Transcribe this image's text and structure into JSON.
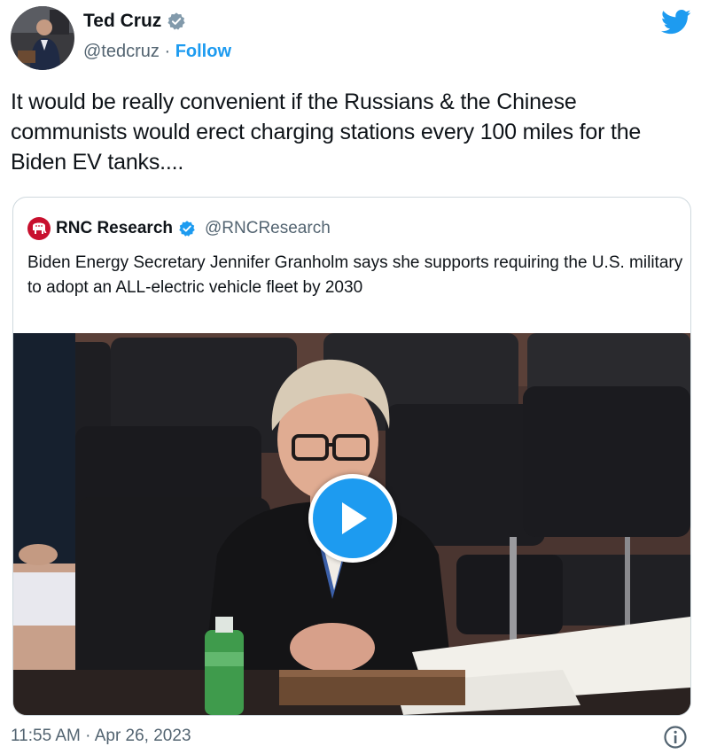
{
  "author": {
    "name": "Ted Cruz",
    "handle": "@tedcruz",
    "separator": "·",
    "follow_label": "Follow",
    "verified_icon": "verified-badge-icon"
  },
  "tweet": {
    "text": "It would be really convenient if the Russians & the Chinese communists would erect charging stations every 100 miles for the Biden EV tanks...."
  },
  "quoted_tweet": {
    "name": "RNC Research",
    "handle": "@RNCResearch",
    "text": "Biden Energy Secretary Jennifer Granholm says she supports requiring the U.S. military to adopt an ALL-electric vehicle fleet by 2030",
    "media_type": "video",
    "play_icon": "play-icon"
  },
  "footer": {
    "timestamp": "11:55 AM · Apr 26, 2023",
    "info_icon": "info-icon"
  },
  "colors": {
    "accent": "#1d9bf0",
    "text": "#0f1419",
    "secondary": "#536471",
    "border": "#cfd9de",
    "rnc_red": "#c8102e"
  }
}
